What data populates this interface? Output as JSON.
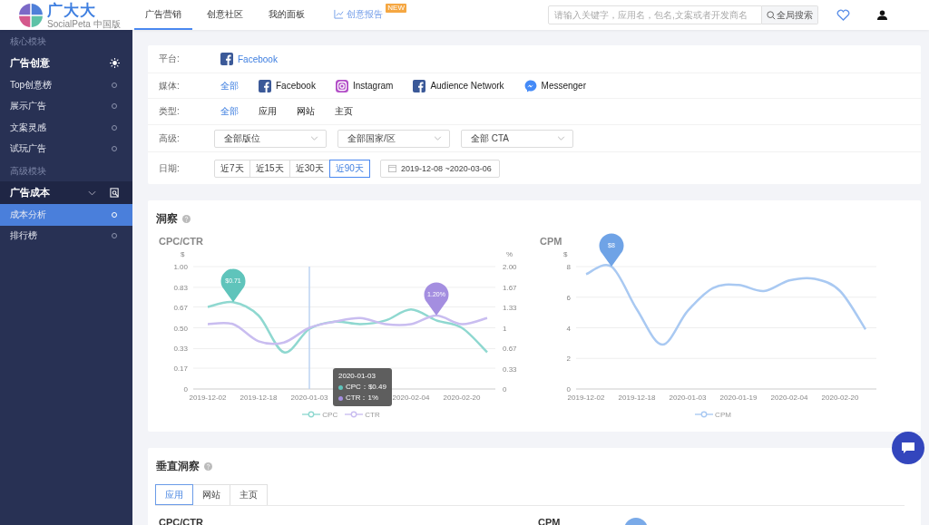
{
  "header": {
    "logo": {
      "name": "广大大",
      "subtitle": "SocialPeta 中国版"
    },
    "nav": [
      {
        "label": "广告营销",
        "kind": "tab",
        "selected": true
      },
      {
        "label": "创意社区",
        "kind": "tab",
        "selected": false
      },
      {
        "label": "我的面板",
        "kind": "tab",
        "selected": false
      },
      {
        "label": "创意报告",
        "kind": "report",
        "badge": "NEW",
        "selected": false
      }
    ],
    "search": {
      "placeholder": "请输入关键字，应用名，包名,文案或者开发商名",
      "button": "全局搜索"
    }
  },
  "sidebar": {
    "sections": [
      {
        "title": "核心模块",
        "groups": [
          {
            "label": "广告创意",
            "items": [
              {
                "label": "Top创意榜",
                "selected": false
              },
              {
                "label": "展示广告",
                "selected": false
              },
              {
                "label": "文案灵感",
                "selected": false
              },
              {
                "label": "试玩广告",
                "selected": false
              }
            ]
          }
        ]
      },
      {
        "title": "高级模块",
        "groups": [
          {
            "label": "广告成本",
            "expanded": true,
            "items": [
              {
                "label": "成本分析",
                "selected": true
              },
              {
                "label": "排行榜",
                "selected": false
              }
            ]
          }
        ]
      }
    ]
  },
  "filters": [
    {
      "label": "平台:",
      "kind": "options",
      "options": [
        {
          "label": "Facebook",
          "kind": "facebook",
          "selected": true
        }
      ]
    },
    {
      "label": "媒体:",
      "kind": "options",
      "options": [
        {
          "label": "全部",
          "kind": "text",
          "selected": true
        },
        {
          "label": "Facebook",
          "kind": "facebook",
          "selected": false
        },
        {
          "label": "Instagram",
          "kind": "instagram",
          "selected": false
        },
        {
          "label": "Audience Network",
          "kind": "facebook",
          "selected": false
        },
        {
          "label": "Messenger",
          "kind": "messenger",
          "selected": false
        }
      ]
    },
    {
      "label": "类型:",
      "kind": "options",
      "options": [
        {
          "label": "全部",
          "kind": "text",
          "selected": true
        },
        {
          "label": "应用",
          "kind": "text",
          "selected": false
        },
        {
          "label": "网站",
          "kind": "text",
          "selected": false
        },
        {
          "label": "主页",
          "kind": "text",
          "selected": false
        }
      ]
    },
    {
      "label": "高级:",
      "kind": "selects",
      "selects": [
        "全部版位",
        "全部国家/区",
        "全部 CTA"
      ]
    },
    {
      "label": "日期:",
      "kind": "dates",
      "ranges": [
        {
          "label": "近7天",
          "selected": false
        },
        {
          "label": "近15天",
          "selected": false
        },
        {
          "label": "近30天",
          "selected": false
        },
        {
          "label": "近90天",
          "selected": true
        }
      ],
      "date_range": "2019-12-08 ~2020-03-06"
    }
  ],
  "insight": {
    "title": "洞察",
    "charts": [
      {
        "chart_data": {
          "type": "line",
          "title": "CPC/CTR",
          "ylabel": "$",
          "categories": [
            "2019-12-02",
            null,
            "2019-12-18",
            null,
            "2020-01-03",
            null,
            null,
            null,
            "2020-02-04",
            null,
            "2020-02-20",
            null
          ],
          "series": [
            {
              "name": "CPC",
              "color": "#8fd8d0",
              "values": [
                0.67,
                0.71,
                0.6,
                0.3,
                0.49,
                0.55,
                0.53,
                0.56,
                0.65,
                0.56,
                0.5,
                0.3
              ]
            },
            {
              "name": "CTR",
              "color": "#c9bdf0",
              "values": [
                0.53,
                0.53,
                0.39,
                0.38,
                0.5,
                0.55,
                0.58,
                0.53,
                0.53,
                0.6,
                0.53,
                0.58
              ]
            }
          ],
          "ylim": [
            0,
            1
          ],
          "yticks": [
            {
              "value": 0,
              "label": "0"
            },
            {
              "value": 0.17,
              "label": "0.17"
            },
            {
              "value": 0.33,
              "label": "0.33"
            },
            {
              "value": 0.5,
              "label": "0.50"
            },
            {
              "value": 0.67,
              "label": "0.67"
            },
            {
              "value": 0.83,
              "label": "0.83"
            },
            {
              "value": 1,
              "label": "1.00"
            }
          ],
          "grid": true,
          "legend": "bottom",
          "annotations": [
            "$0.71",
            "1.20%"
          ]
        },
        "right_axis": {
          "label": "%",
          "ticks": [
            "2.00",
            "1.67",
            "1.33",
            "1",
            "0.67",
            "0.33",
            "0"
          ]
        },
        "tooltip": {
          "title": "2020-01-03",
          "rows": [
            {
              "text": "CPC：$0.49",
              "color": "#5fc4bb"
            },
            {
              "text": "CTR：1%",
              "color": "#a48ee0"
            }
          ]
        }
      },
      {
        "chart_data": {
          "type": "line",
          "title": "CPM",
          "ylabel": "$",
          "categories": [
            "2019-12-02",
            null,
            "2019-12-18",
            null,
            "2020-01-03",
            null,
            "2020-01-19",
            null,
            "2020-02-04",
            null,
            "2020-02-20",
            null
          ],
          "series": [
            {
              "name": "CPM",
              "color": "#a9c9f2",
              "values": [
                7.5,
                8,
                5.2,
                2.9,
                5.1,
                6.6,
                6.8,
                6.4,
                7.1,
                7.2,
                6.4,
                3.9
              ]
            }
          ],
          "ylim": [
            0,
            8
          ],
          "yticks": [
            {
              "value": 0,
              "label": "0"
            },
            {
              "value": 2,
              "label": "2"
            },
            {
              "value": 4,
              "label": "4"
            },
            {
              "value": 6,
              "label": "6"
            },
            {
              "value": 8,
              "label": "8"
            }
          ],
          "grid": true,
          "legend": "bottom",
          "annotations": [
            "$8"
          ]
        }
      }
    ]
  },
  "vertical": {
    "title": "垂直洞察",
    "tabs": [
      {
        "label": "应用",
        "selected": true
      },
      {
        "label": "网站",
        "selected": false
      },
      {
        "label": "主页",
        "selected": false
      }
    ],
    "chart_titles": [
      "CPC/CTR",
      "CPM"
    ]
  }
}
